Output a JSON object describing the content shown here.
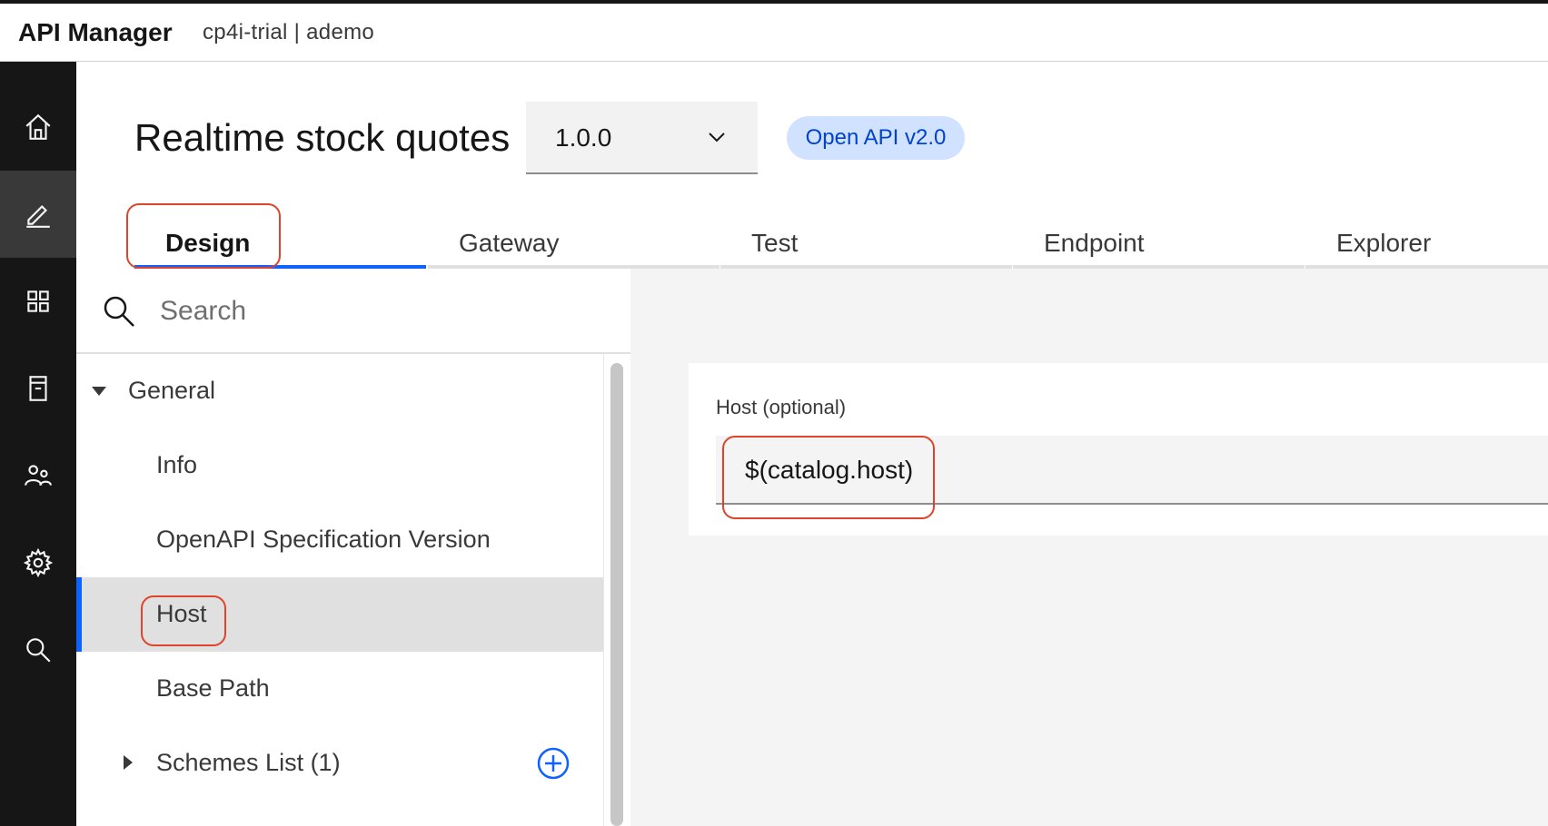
{
  "header": {
    "brand": "API Manager",
    "breadcrumb": "cp4i-trial  |  ademo"
  },
  "rail": {
    "items": [
      {
        "icon": "home-icon",
        "active": false
      },
      {
        "icon": "edit-icon",
        "active": true
      },
      {
        "icon": "apps-grid-icon",
        "active": false
      },
      {
        "icon": "catalog-icon",
        "active": false
      },
      {
        "icon": "users-icon",
        "active": false
      },
      {
        "icon": "gear-icon",
        "active": false
      },
      {
        "icon": "search-icon",
        "active": false
      }
    ]
  },
  "api": {
    "title": "Realtime stock quotes",
    "version": "1.0.0",
    "spec_tag": "Open API v2.0"
  },
  "tabs": [
    {
      "label": "Design",
      "active": true
    },
    {
      "label": "Gateway",
      "active": false
    },
    {
      "label": "Test",
      "active": false
    },
    {
      "label": "Endpoint",
      "active": false
    },
    {
      "label": "Explorer",
      "active": false
    }
  ],
  "nav": {
    "search_placeholder": "Search",
    "items": [
      {
        "label": "General",
        "level": 0,
        "expanded": true
      },
      {
        "label": "Info",
        "level": 1
      },
      {
        "label": "OpenAPI Specification Version",
        "level": 1
      },
      {
        "label": "Host",
        "level": 1,
        "selected": true
      },
      {
        "label": "Base Path",
        "level": 1
      },
      {
        "label": "Schemes List (1)",
        "level": 1,
        "expandable": true
      }
    ]
  },
  "host_form": {
    "label": "Host (optional)",
    "value": "$(catalog.host)"
  },
  "colors": {
    "accent": "#0f62fe",
    "tag_bg": "#d0e2ff",
    "tag_text": "#0043ce",
    "annotation": "#e0432b",
    "rail_bg": "#161616"
  }
}
